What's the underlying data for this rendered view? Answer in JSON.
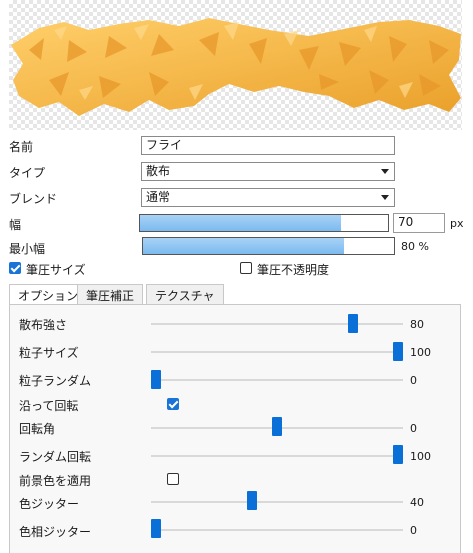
{
  "brush": {
    "name_label": "名前",
    "name_value": "フライ",
    "type_label": "タイプ",
    "type_value": "散布",
    "blend_label": "ブレンド",
    "blend_value": "通常",
    "width_label": "幅",
    "width_value": "70",
    "width_unit": "px",
    "width_fraction": 0.81,
    "minwidth_label": "最小幅",
    "minwidth_value": "80 %",
    "minwidth_fraction": 0.8,
    "pressure_size_label": "筆圧サイズ",
    "pressure_size_checked": true,
    "pressure_opacity_label": "筆圧不透明度",
    "pressure_opacity_checked": false
  },
  "tabs": [
    {
      "label": "オプション",
      "active": true
    },
    {
      "label": "筆圧補正",
      "active": false
    },
    {
      "label": "テクスチャ",
      "active": false
    }
  ],
  "options": {
    "scatter_strength": {
      "label": "散布強さ",
      "value": "80",
      "fraction": 0.8
    },
    "particle_size": {
      "label": "粒子サイズ",
      "value": "100",
      "fraction": 1.0
    },
    "particle_random": {
      "label": "粒子ランダム",
      "value": "0",
      "fraction": 0.0
    },
    "rotate_along": {
      "label": "沿って回転",
      "checked": true
    },
    "rotation_angle": {
      "label": "回転角",
      "value": "0",
      "fraction": 0.5
    },
    "random_rotation": {
      "label": "ランダム回転",
      "value": "100",
      "fraction": 1.0
    },
    "apply_fg_color": {
      "label": "前景色を適用",
      "checked": false
    },
    "color_jitter": {
      "label": "色ジッター",
      "value": "40",
      "fraction": 0.4
    },
    "hue_jitter": {
      "label": "色相ジッター",
      "value": "0",
      "fraction": 0.0
    }
  },
  "colors": {
    "accent": "#0a6fd6",
    "stroke_orange": "#f5b43c",
    "stroke_dark": "#e89a1a"
  }
}
